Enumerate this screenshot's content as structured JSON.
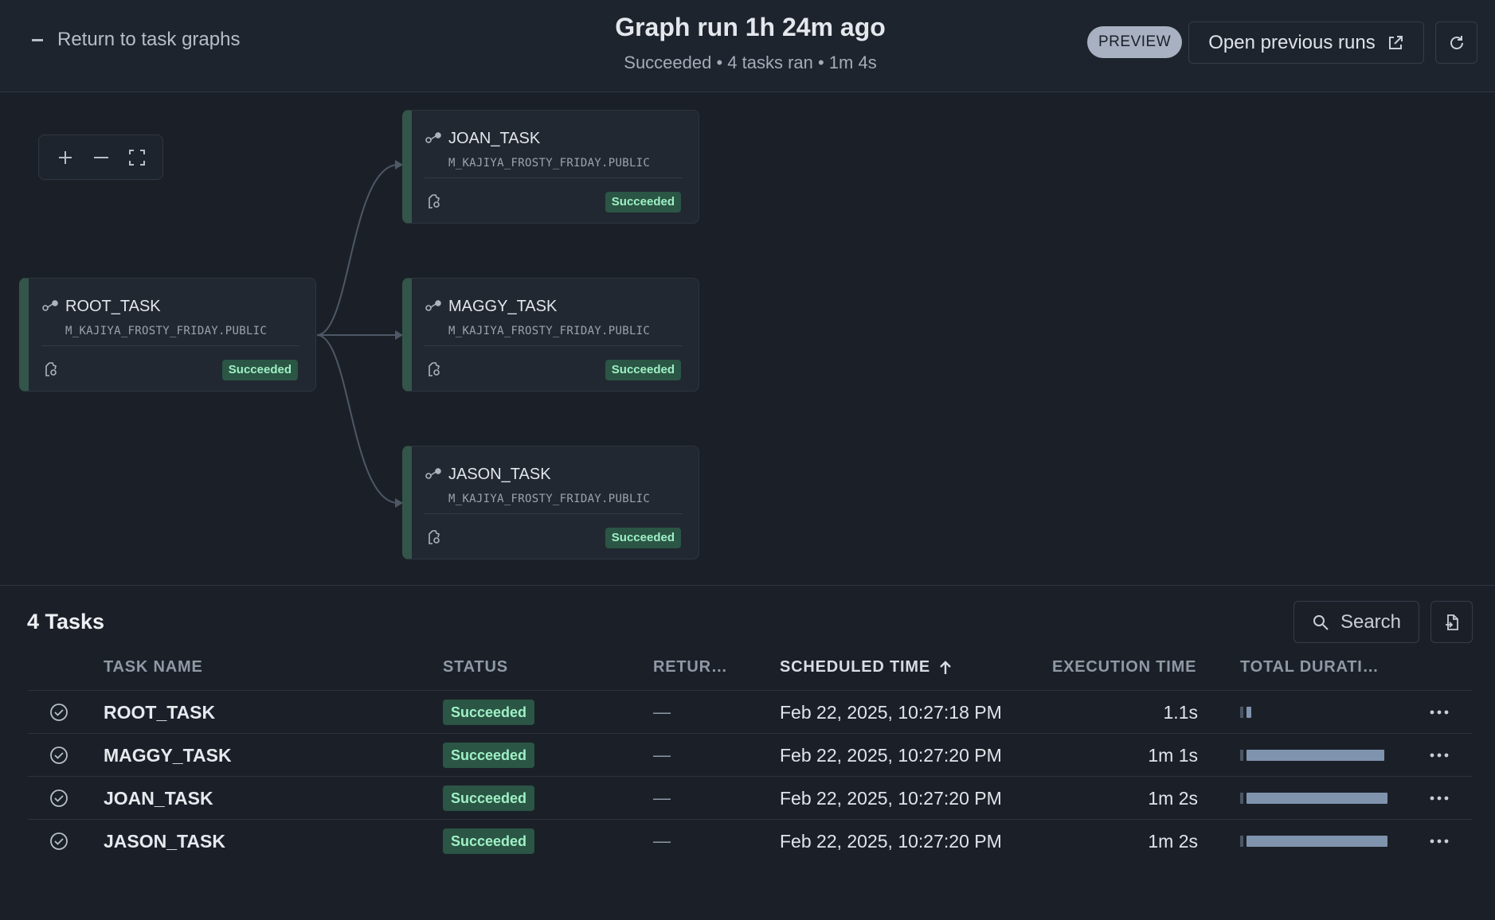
{
  "header": {
    "back_label": "Return to task graphs",
    "title": "Graph run 1h 24m ago",
    "subtitle": "Succeeded • 4 tasks ran • 1m 4s",
    "preview_badge": "PREVIEW",
    "open_previous_label": "Open previous runs"
  },
  "graph": {
    "nodes": [
      {
        "name": "ROOT_TASK",
        "schema": "M_KAJIYA_FROSTY_FRIDAY.PUBLIC",
        "status": "Succeeded"
      },
      {
        "name": "JOAN_TASK",
        "schema": "M_KAJIYA_FROSTY_FRIDAY.PUBLIC",
        "status": "Succeeded"
      },
      {
        "name": "MAGGY_TASK",
        "schema": "M_KAJIYA_FROSTY_FRIDAY.PUBLIC",
        "status": "Succeeded"
      },
      {
        "name": "JASON_TASK",
        "schema": "M_KAJIYA_FROSTY_FRIDAY.PUBLIC",
        "status": "Succeeded"
      }
    ]
  },
  "tasks": {
    "title": "4 Tasks",
    "search_label": "Search",
    "columns": [
      "TASK NAME",
      "STATUS",
      "RETUR…",
      "SCHEDULED TIME",
      "EXECUTION TIME",
      "TOTAL DURATI…"
    ],
    "sort_column": "SCHEDULED TIME",
    "rows": [
      {
        "name": "ROOT_TASK",
        "status": "Succeeded",
        "return": "—",
        "scheduled": "Feb 22, 2025, 10:27:18 PM",
        "execution": "1.1s",
        "duration_fraction": 0.02
      },
      {
        "name": "MAGGY_TASK",
        "status": "Succeeded",
        "return": "—",
        "scheduled": "Feb 22, 2025, 10:27:20 PM",
        "execution": "1m 1s",
        "duration_fraction": 0.95
      },
      {
        "name": "JOAN_TASK",
        "status": "Succeeded",
        "return": "—",
        "scheduled": "Feb 22, 2025, 10:27:20 PM",
        "execution": "1m 2s",
        "duration_fraction": 0.97
      },
      {
        "name": "JASON_TASK",
        "status": "Succeeded",
        "return": "—",
        "scheduled": "Feb 22, 2025, 10:27:20 PM",
        "execution": "1m 2s",
        "duration_fraction": 0.97
      }
    ]
  },
  "colors": {
    "background": "#1b2028",
    "success_bg": "#2b5544",
    "success_text": "#9ff0c6",
    "duration_bar": "#8093ad",
    "node_accent": "#345549"
  },
  "icons": {
    "back": "minus-icon",
    "open_previous": "external-link-icon",
    "refresh": "refresh-icon",
    "zoom_in": "plus-icon",
    "zoom_out": "minus-icon",
    "fit": "fit-screen-icon",
    "task": "task-type-icon",
    "task_gear": "task-config-icon",
    "row_check": "check-circle-icon",
    "row_menu": "more-icon",
    "search": "search-icon",
    "export": "export-icon"
  }
}
